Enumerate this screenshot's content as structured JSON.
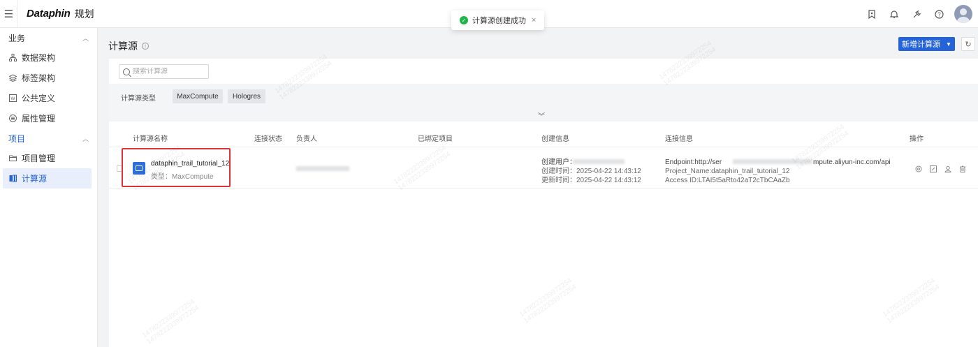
{
  "topbar": {
    "logo": "Dataphin",
    "module": "规划",
    "icons": [
      "tag-icon",
      "bell-icon",
      "tools-icon",
      "help-icon",
      "avatar"
    ]
  },
  "toast": {
    "message": "计算源创建成功",
    "close": "×"
  },
  "sidebar": {
    "group_business": "业务",
    "business_items": [
      {
        "label": "数据架构",
        "icon": "architecture-icon"
      },
      {
        "label": "标签架构",
        "icon": "tag-layers-icon"
      },
      {
        "label": "公共定义",
        "icon": "word-doc-icon"
      },
      {
        "label": "属性管理",
        "icon": "list-circle-icon"
      }
    ],
    "group_project": "项目",
    "project_items": [
      {
        "label": "项目管理",
        "icon": "folder-icon"
      },
      {
        "label": "计算源",
        "icon": "compute-icon",
        "active": true
      }
    ]
  },
  "main": {
    "title": "计算源",
    "new_button": "新增计算源",
    "search_placeholder": "搜索计算源",
    "filter_label": "计算源类型",
    "filter_chips": [
      "MaxCompute",
      "Hologres"
    ],
    "expand_glyph": "︾",
    "columns": [
      "计算源名称",
      "连接状态",
      "负责人",
      "已绑定项目",
      "创建信息",
      "连接信息",
      "操作"
    ],
    "row": {
      "name": "dataphin_trail_tutorial_12",
      "type": "类型：MaxCompute",
      "create_user_label": "创建用户：",
      "create_time": "创建时间：2025-04-22 14:43:12",
      "update_time": "更新时间：2025-04-22 14:43:12",
      "endpoint_prefix": "Endpoint:http://ser",
      "endpoint_suffix": "mpute.aliyun-inc.com/api",
      "project_name": "Project_Name:dataphin_trail_tutorial_12",
      "access_id": "Access ID:LTAI5t5aRto42aT2cTbCAaZb"
    },
    "op_icons": [
      "copy-icon",
      "edit-icon",
      "user-icon",
      "delete-icon"
    ]
  },
  "watermark": {
    "line1": "1478222339972254",
    "line2": "1478222339972254"
  },
  "colors": {
    "primary": "#2563d9",
    "highlight": "#e0303a",
    "success": "#1fb54a"
  }
}
